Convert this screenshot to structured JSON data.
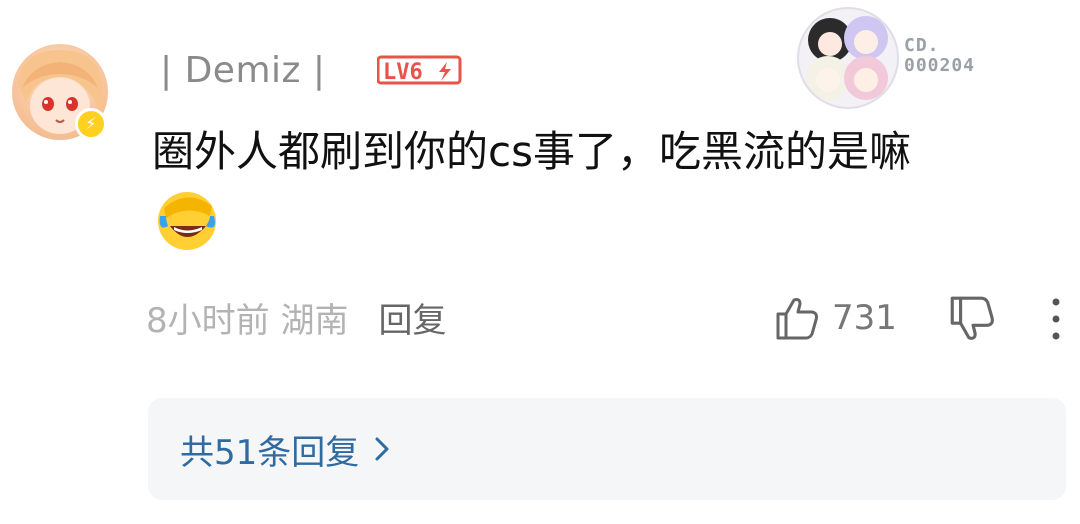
{
  "comment": {
    "username": "| Demiz |",
    "level_label": "LV6",
    "fan_badge_number_line1": "CD.",
    "fan_badge_number_line2": "000204",
    "text": "圈外人都刷到你的cs事了，吃黑流的是嘛",
    "emoji": "laughing-crying-emoji",
    "time_location": "8小时前 湖南",
    "reply_label": "回复",
    "like_count": "731",
    "replies_link_label": "共51条回复",
    "colors": {
      "level_badge": "#e8534a",
      "replies_link": "#2f6aa0",
      "avatar_badge": "#ffd01f"
    }
  }
}
